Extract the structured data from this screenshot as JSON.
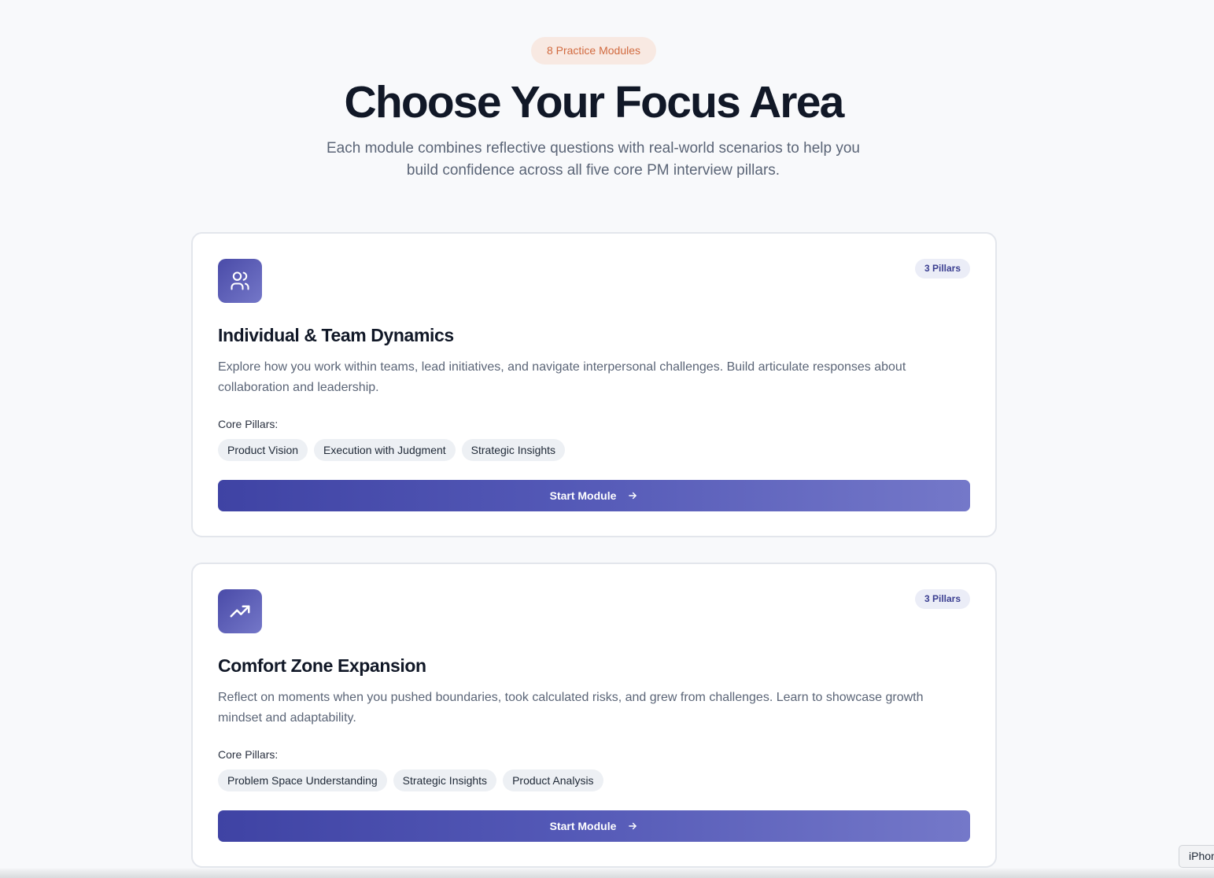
{
  "header": {
    "badge": "8 Practice Modules",
    "title": "Choose Your Focus Area",
    "subtitle": "Each module combines reflective questions with real-world scenarios to help you build confidence across all five core PM interview pillars."
  },
  "modules": [
    {
      "icon": "users-icon",
      "pillar_count": "3 Pillars",
      "title": "Individual & Team Dynamics",
      "description": "Explore how you work within teams, lead initiatives, and navigate interpersonal challenges. Build articulate responses about collaboration and leadership.",
      "pillars_label": "Core Pillars:",
      "pillars": [
        "Product Vision",
        "Execution with Judgment",
        "Strategic Insights"
      ],
      "button_label": "Start Module"
    },
    {
      "icon": "trending-up-icon",
      "pillar_count": "3 Pillars",
      "title": "Comfort Zone Expansion",
      "description": "Reflect on moments when you pushed boundaries, took calculated risks, and grew from challenges. Learn to showcase growth mindset and adaptability.",
      "pillars_label": "Core Pillars:",
      "pillars": [
        "Problem Space Understanding",
        "Strategic Insights",
        "Product Analysis"
      ],
      "button_label": "Start Module"
    }
  ],
  "device_toolbar": {
    "label": "iPhone"
  },
  "colors": {
    "accent_gradient_start": "#3f43a4",
    "accent_gradient_end": "#7478c9",
    "badge_bg": "#f8e9e2",
    "badge_text": "#d16a3f",
    "page_bg": "#f8f9fb"
  }
}
